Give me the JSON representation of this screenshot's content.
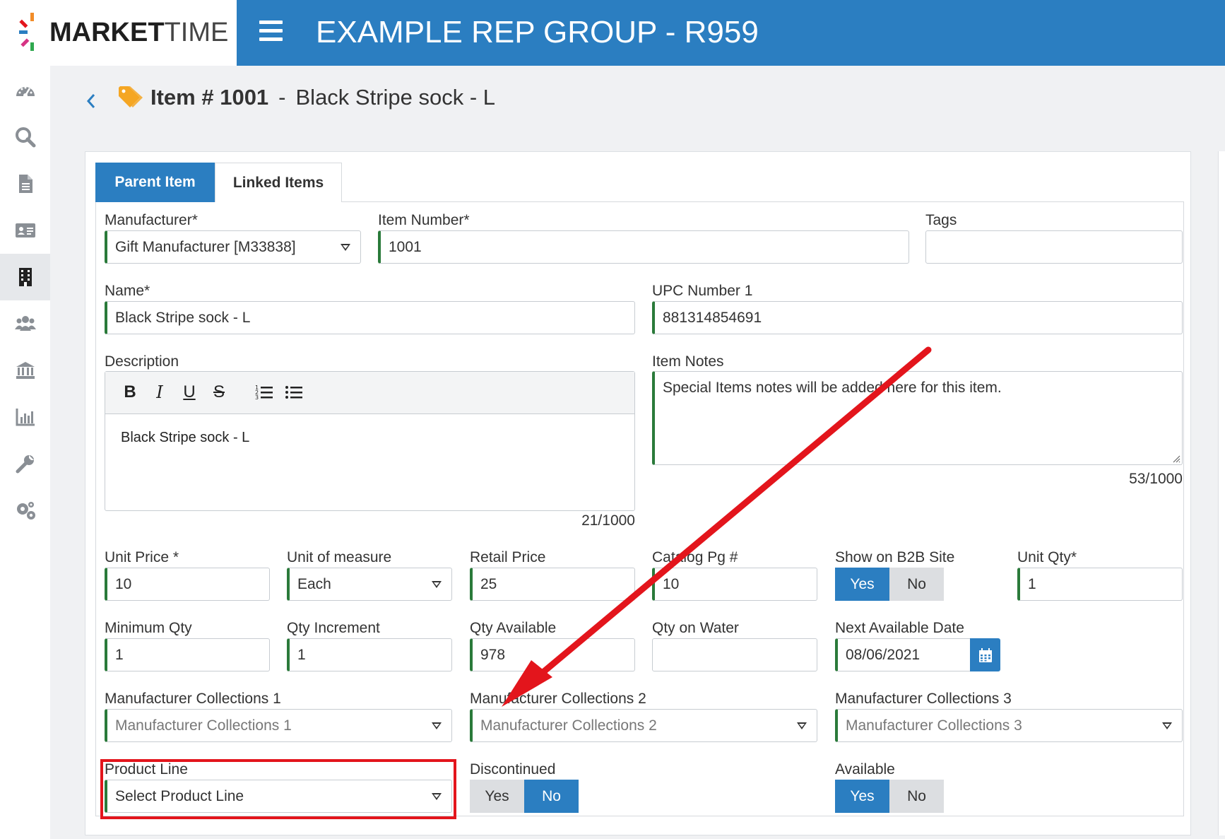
{
  "app": {
    "logo_bold": "MARKET",
    "logo_light": "TIME",
    "org_title": "EXAMPLE REP GROUP - R959"
  },
  "colors": {
    "accent": "#2b7ec1",
    "valid_border": "#2a7a3a",
    "annotation": "#e3151c"
  },
  "sidebar": {
    "items": [
      {
        "icon": "dashboard-icon"
      },
      {
        "icon": "search-icon"
      },
      {
        "icon": "document-icon"
      },
      {
        "icon": "contact-card-icon"
      },
      {
        "icon": "building-icon",
        "active": true
      },
      {
        "icon": "users-icon"
      },
      {
        "icon": "bank-icon"
      },
      {
        "icon": "bar-chart-icon"
      },
      {
        "icon": "wrench-icon"
      },
      {
        "icon": "settings-gears-icon"
      }
    ]
  },
  "page": {
    "title_prefix": "Item # 1001",
    "title_sep": "-",
    "title_name": "Black Stripe sock - L"
  },
  "tabs": [
    {
      "label": "Parent Item",
      "active": true
    },
    {
      "label": "Linked Items",
      "active": false
    }
  ],
  "form": {
    "manufacturer": {
      "label": "Manufacturer*",
      "value": "Gift Manufacturer [M33838]"
    },
    "item_number": {
      "label": "Item Number*",
      "value": "1001"
    },
    "tags": {
      "label": "Tags",
      "value": ""
    },
    "name": {
      "label": "Name*",
      "value": "Black Stripe sock - L"
    },
    "upc": {
      "label": "UPC Number 1",
      "value": "881314854691"
    },
    "description": {
      "label": "Description",
      "value": "Black Stripe sock - L",
      "counter": "21/1000",
      "toolbar": {
        "bold": "B",
        "italic": "I",
        "underline": "U",
        "strike": "S"
      }
    },
    "item_notes": {
      "label": "Item Notes",
      "value": "Special Items notes will be added here for this item.",
      "counter": "53/1000"
    },
    "unit_price": {
      "label": "Unit Price *",
      "value": "10"
    },
    "unit_of_measure": {
      "label": "Unit of measure",
      "value": "Each"
    },
    "retail_price": {
      "label": "Retail Price",
      "value": "25"
    },
    "catalog_pg": {
      "label": "Catalog Pg #",
      "value": "10"
    },
    "show_b2b": {
      "label": "Show on B2B Site",
      "yes": "Yes",
      "no": "No",
      "selected": "Yes"
    },
    "unit_qty": {
      "label": "Unit Qty*",
      "value": "1"
    },
    "minimum_qty": {
      "label": "Minimum Qty",
      "value": "1"
    },
    "qty_increment": {
      "label": "Qty Increment",
      "value": "1"
    },
    "qty_available": {
      "label": "Qty Available",
      "value": "978"
    },
    "qty_on_water": {
      "label": "Qty on Water",
      "value": ""
    },
    "next_available_date": {
      "label": "Next Available Date",
      "value": "08/06/2021"
    },
    "mfr_collections_1": {
      "label": "Manufacturer Collections 1",
      "placeholder": "Manufacturer Collections 1"
    },
    "mfr_collections_2": {
      "label": "Manufacturer Collections 2",
      "placeholder": "Manufacturer Collections 2"
    },
    "mfr_collections_3": {
      "label": "Manufacturer Collections 3",
      "placeholder": "Manufacturer Collections 3"
    },
    "product_line": {
      "label": "Product Line",
      "placeholder": "Select Product Line"
    },
    "discontinued": {
      "label": "Discontinued",
      "yes": "Yes",
      "no": "No",
      "selected": "No"
    },
    "available": {
      "label": "Available",
      "yes": "Yes",
      "no": "No",
      "selected": "Yes"
    }
  }
}
